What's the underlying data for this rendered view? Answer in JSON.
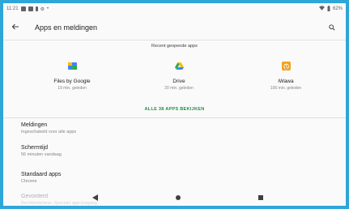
{
  "status_bar": {
    "time": "11:21",
    "battery": "62%"
  },
  "app_bar": {
    "title": "Apps en meldingen"
  },
  "recent": {
    "header": "Recent geopende apps",
    "apps": [
      {
        "name": "Files by Google",
        "time": "19 min. geleden",
        "icon": "files-by-google-icon"
      },
      {
        "name": "Drive",
        "time": "20 min. geleden",
        "icon": "drive-icon"
      },
      {
        "name": "iWawa",
        "time": "106 min. geleden",
        "icon": "iwawa-icon"
      }
    ],
    "see_all": "ALLE 38 APPS BEKIJKEN"
  },
  "settings": [
    {
      "title": "Meldingen",
      "subtitle": "Ingeschakeld voor alle apps"
    },
    {
      "title": "Schermtijd",
      "subtitle": "56 minuten vandaag"
    },
    {
      "title": "Standaard apps",
      "subtitle": "Chrome"
    },
    {
      "title": "Gevorderd",
      "subtitle": "Rechtenbeheer, Speciale app-toegang"
    }
  ],
  "colors": {
    "frame": "#2ea6d8",
    "accent": "#1e8e3e"
  }
}
